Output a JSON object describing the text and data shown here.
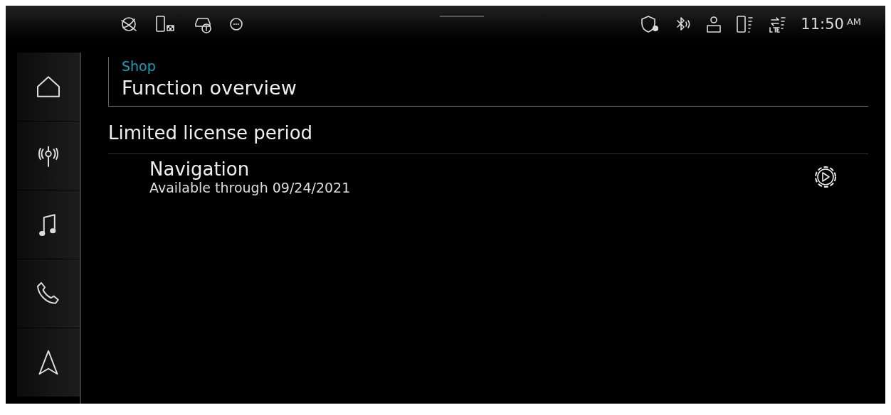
{
  "status_bar": {
    "time": "11:50",
    "period": "AM"
  },
  "header": {
    "breadcrumb": "Shop",
    "title": "Function overview"
  },
  "section": {
    "title": "Limited license period",
    "items": [
      {
        "title": "Navigation",
        "subtitle": "Available through 09/24/2021"
      }
    ]
  }
}
